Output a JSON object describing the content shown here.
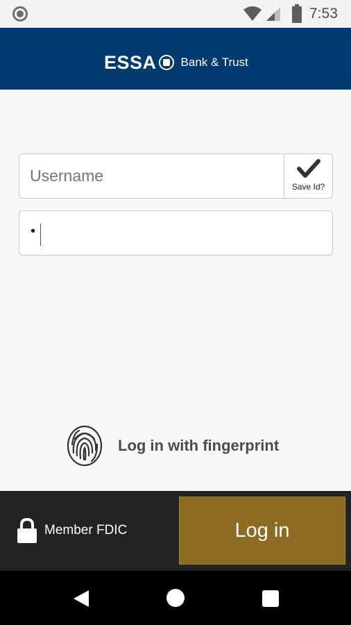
{
  "status_bar": {
    "time": "7:53",
    "icons": [
      "status-dot-icon",
      "wifi-icon",
      "signal-icon",
      "battery-icon"
    ]
  },
  "header": {
    "brand_name": "ESSA",
    "brand_sub": "Bank & Trust",
    "background": "#013a6e"
  },
  "login_form": {
    "username": {
      "placeholder": "Username",
      "value": ""
    },
    "save_id": {
      "label": "Save Id?",
      "checked": true
    },
    "password": {
      "value": "•"
    }
  },
  "fingerprint": {
    "label": "Log in with fingerprint",
    "icon": "fingerprint-icon"
  },
  "footer": {
    "fdic_label": "Member FDIC",
    "login_button": "Log in",
    "accent": "#8c6b22"
  },
  "nav": {
    "icons": [
      "back-icon",
      "home-icon",
      "recents-icon"
    ]
  }
}
